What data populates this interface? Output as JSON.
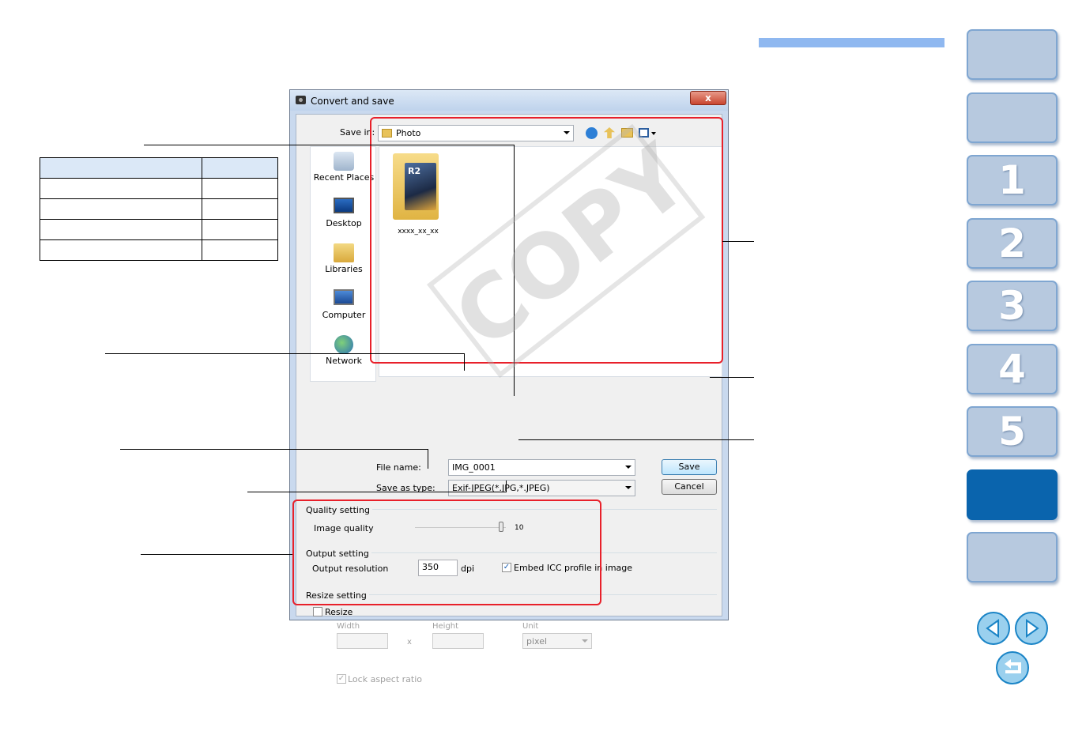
{
  "dialog": {
    "title": "Convert and save",
    "close_label": "x",
    "save_in_label": "Save in:",
    "save_in_value": "Photo",
    "folder_name": "xxxx_xx_xx",
    "folder_badge": "R2",
    "places": [
      "Recent Places",
      "Desktop",
      "Libraries",
      "Computer",
      "Network"
    ],
    "file_name_label": "File name:",
    "file_name_value": "IMG_0001",
    "save_type_label": "Save as type:",
    "save_type_value": "Exif-JPEG(*.JPG,*.JPEG)",
    "save_button": "Save",
    "cancel_button": "Cancel",
    "quality_group": "Quality setting",
    "image_quality_label": "Image quality",
    "image_quality_value": "10",
    "output_group": "Output setting",
    "output_resolution_label": "Output resolution",
    "output_resolution_value": "350",
    "dpi_label": "dpi",
    "embed_icc_label": "Embed ICC profile in image",
    "embed_icc_checked": true,
    "resize_group": "Resize setting",
    "resize_label": "Resize",
    "resize_checked": false,
    "width_label": "Width",
    "height_label": "Height",
    "unit_label": "Unit",
    "x_label": "x",
    "unit_value": "pixel",
    "lock_aspect_label": "Lock aspect ratio"
  },
  "watermark": "COPY",
  "nav_tabs": [
    {
      "label": "",
      "active": false
    },
    {
      "label": "",
      "active": false
    },
    {
      "label": "1",
      "active": false
    },
    {
      "label": "2",
      "active": false
    },
    {
      "label": "3",
      "active": false
    },
    {
      "label": "4",
      "active": false
    },
    {
      "label": "5",
      "active": false
    },
    {
      "label": "",
      "active": true
    },
    {
      "label": "",
      "active": false
    }
  ],
  "nav_icons": [
    "prev-page-icon",
    "next-page-icon",
    "return-icon"
  ],
  "colors": {
    "accent_blue": "#0a64ad",
    "tab_inactive": "#b7c9df",
    "highlight_red": "#e8202a",
    "top_bar": "#8fb8f0"
  }
}
